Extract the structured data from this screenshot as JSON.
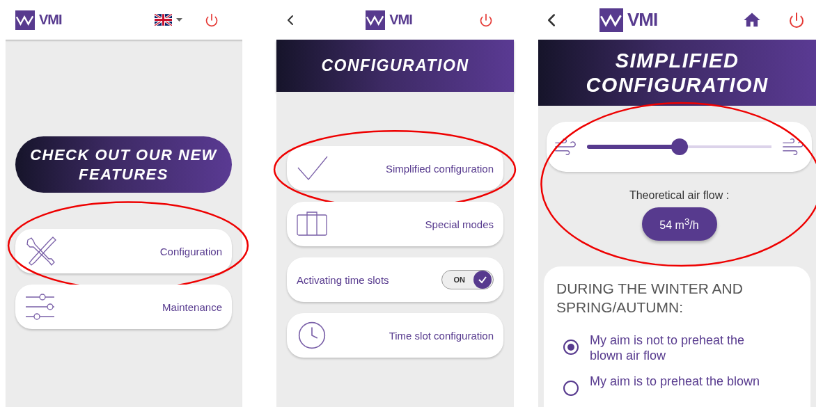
{
  "screens": [
    {
      "kind": "home",
      "logo": "VMI",
      "banner": "CHECK OUT OUR NEW FEATURES",
      "items": [
        {
          "kind": "link",
          "label": "Configuration",
          "circled": true
        },
        {
          "kind": "link",
          "label": "Maintenance",
          "circled": false
        }
      ]
    },
    {
      "kind": "menu",
      "logo": "VMI",
      "title": "CONFIGURATION",
      "items": [
        {
          "kind": "link",
          "label": "Simplified configuration",
          "circled": true
        },
        {
          "kind": "link",
          "label": "Special modes",
          "circled": false
        },
        {
          "kind": "toggle",
          "label": "Activating time slots",
          "toggle_text": "ON",
          "on": true,
          "circled": false
        },
        {
          "kind": "link",
          "label": "Time slot configuration",
          "circled": false
        }
      ]
    },
    {
      "kind": "detail",
      "logo": "VMI",
      "title": "SIMPLIFIED CONFIGURATION",
      "airflow": {
        "level": 0.5,
        "label": "Theoretical air flow :",
        "value": "54 m$^{3}$/h",
        "circled": true
      },
      "section": {
        "heading": "DURING THE WINTER AND SPRING/AUTUMN:",
        "options": [
          {
            "label": "My aim is not to preheat the blown air flow",
            "selected": true
          },
          {
            "label": "My aim is to preheat the blown",
            "selected": false
          }
        ]
      }
    }
  ]
}
